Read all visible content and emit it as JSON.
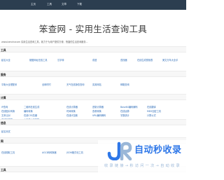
{
  "topbar": {
    "nav": [
      "主页",
      "工具",
      "文章",
      "下载"
    ]
  },
  "page": {
    "title": "笨查网 - 实用生活查询工具"
  },
  "intro": {
    "text": "www.benchacom 实用生活查询工具，致力于为用户提供方便、快捷的生活查询服务..."
  },
  "sections": [
    {
      "head": "工具",
      "links": [
        "起名大全",
        "梗图网址在线工具",
        "汉字转",
        "成语",
        "查找器",
        "在线生成属相表",
        "美文万年大全手"
      ]
    },
    {
      "head": "服务",
      "links": [
        "平衡大全搭配系",
        "全网时时",
        "天气在线静态查询",
        "实用网站",
        "邮箱查询"
      ]
    },
    {
      "head": "计算",
      "links": [
        "IP查询",
        "二维码在线生成",
        "在线计算器",
        "进制计算器",
        "Base64编码解码",
        "在线翻译",
        "在线图片转换",
        "编码转换",
        "时间转换",
        "查看转换",
        "在线运算",
        "MD5加密工具",
        "文本比对",
        "在线CSS压缩",
        "在线JS压缩",
        "URL编码解码",
        "字数统计",
        "计算公式",
        "在线加解密",
        "人民币大写转换"
      ]
    },
    {
      "head": "信息",
      "links": [
        "起名测试"
      ]
    },
    {
      "head": "网",
      "links": [
        "在线爬取工具",
        "AGCI码转换器",
        "JSON格式化工具"
      ]
    },
    {
      "head": "工具",
      "links": []
    }
  ],
  "watermark": {
    "main": "自动秒收录",
    "sub": "收 录 链 接 → 秒 访 问 一 次 → 自 动 收 录",
    "colors": {
      "blue": "#2e77e8",
      "light": "#9ab7d8"
    }
  }
}
